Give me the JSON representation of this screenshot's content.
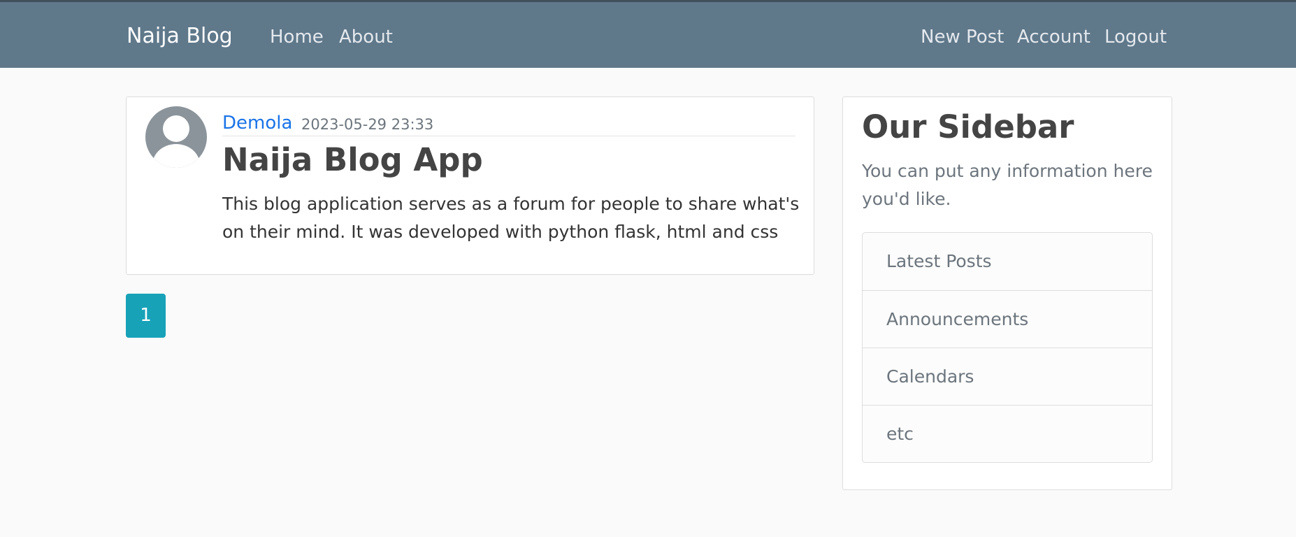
{
  "navbar": {
    "brand": "Naija Blog",
    "left_links": [
      "Home",
      "About"
    ],
    "right_links": [
      "New Post",
      "Account",
      "Logout"
    ]
  },
  "posts": [
    {
      "author": "Demola",
      "date": "2023-05-29 23:33",
      "title": "Naija Blog App",
      "content": "This blog application serves as a forum for people to share what's on their mind. It was developed with python flask, html and css",
      "avatar_icon": "user-avatar-icon"
    }
  ],
  "pagination": {
    "current_page": "1"
  },
  "sidebar": {
    "title": "Our Sidebar",
    "text": "You can put any information here you'd like.",
    "items": [
      "Latest Posts",
      "Announcements",
      "Calendars",
      "etc"
    ]
  },
  "colors": {
    "navbar": "#5f788a",
    "link": "#1a73e8",
    "pagination": "#17a2b8",
    "background": "#fafafa"
  }
}
